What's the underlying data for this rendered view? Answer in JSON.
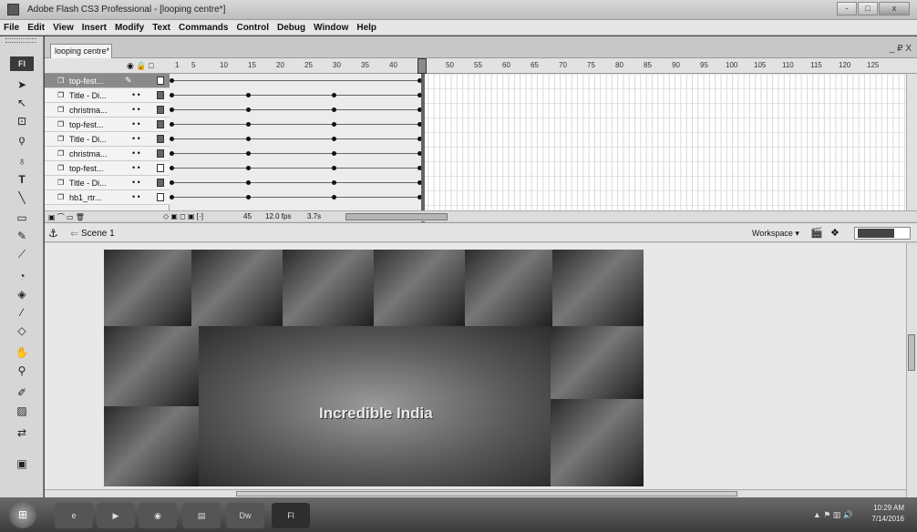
{
  "window": {
    "title": "Adobe Flash CS3 Professional - [looping centre*]",
    "minimize": "-",
    "maximize": "□",
    "close": "x"
  },
  "menu": [
    "File",
    "Edit",
    "View",
    "Insert",
    "Modify",
    "Text",
    "Commands",
    "Control",
    "Debug",
    "Window",
    "Help"
  ],
  "toolbox": {
    "label": "Fl",
    "tools": [
      "arrow-icon",
      "subselect-icon",
      "free-transform-icon",
      "lasso-icon",
      "pen-icon",
      "text-icon",
      "line-icon",
      "rectangle-icon",
      "pencil-icon",
      "brush-icon",
      "ink-bottle-icon",
      "paint-bucket-icon",
      "eyedropper-icon",
      "eraser-icon",
      "hand-icon",
      "zoom-icon",
      "stroke-color-icon",
      "fill-color-icon",
      "swap-colors-icon",
      "options-icon"
    ]
  },
  "document": {
    "tab": "looping centre*",
    "window_controls": "_ ₽ X"
  },
  "timeline": {
    "header_icons": "◉ 🔒 □",
    "frame_numbers": [
      "1",
      "5",
      "10",
      "15",
      "20",
      "25",
      "30",
      "35",
      "40",
      "45",
      "50",
      "55",
      "60",
      "65",
      "70",
      "75",
      "80",
      "85",
      "90",
      "95",
      "100",
      "105",
      "110",
      "115",
      "120",
      "125"
    ],
    "layers": [
      {
        "name": "top-fest...",
        "selected": true,
        "pencil": "✎"
      },
      {
        "name": "Title - Di..."
      },
      {
        "name": "christma..."
      },
      {
        "name": "top-fest..."
      },
      {
        "name": "Title - Di..."
      },
      {
        "name": "christma..."
      },
      {
        "name": "top-fest..."
      },
      {
        "name": "Title - Di..."
      },
      {
        "name": "hb1_rtr..."
      }
    ],
    "footer": {
      "frame": "45",
      "fps": "12.0 fps",
      "time": "3.7s"
    }
  },
  "editbar": {
    "scene": "Scene 1",
    "workspace": "Workspace ▾"
  },
  "stage": {
    "headline": "Incredible India"
  },
  "taskbar": {
    "apps": [
      "Dw",
      "Fl"
    ],
    "time": "10:29 AM",
    "date": "7/14/2016"
  }
}
